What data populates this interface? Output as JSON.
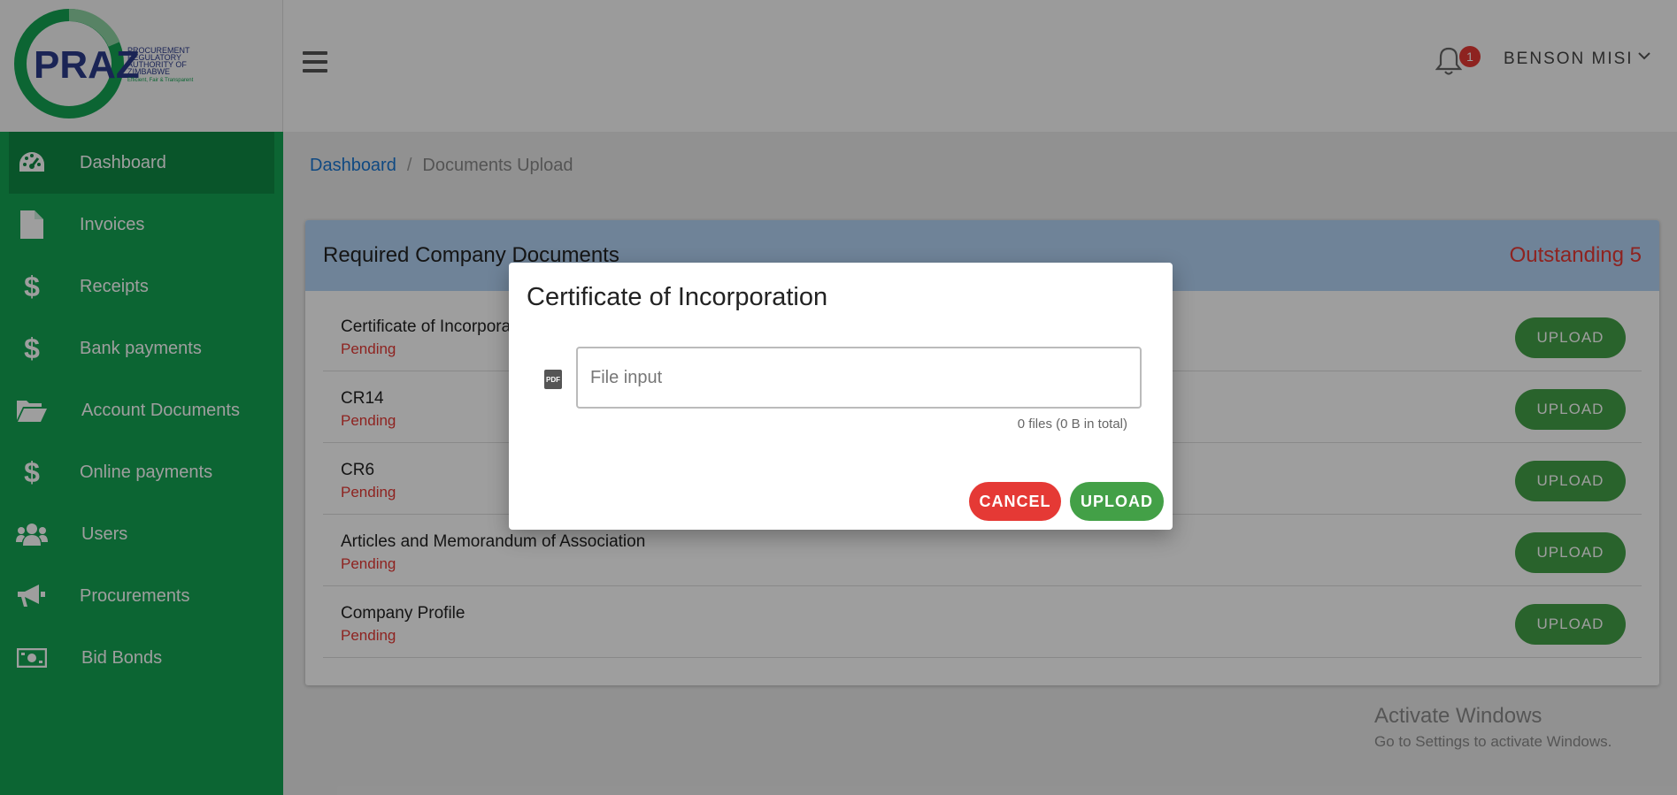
{
  "logo": {
    "acronym": "PRAZ",
    "name_lines": [
      "PROCUREMENT",
      "REGULATORY",
      "AUTHORITY OF",
      "ZIMBABWE"
    ],
    "tagline": "Efficient, Fair & Transparent"
  },
  "sidebar": {
    "items": [
      {
        "label": "Dashboard",
        "icon": "dashboard-gauge-icon"
      },
      {
        "label": "Invoices",
        "icon": "file-icon"
      },
      {
        "label": "Receipts",
        "icon": "dollar-icon"
      },
      {
        "label": "Bank payments",
        "icon": "dollar-icon"
      },
      {
        "label": "Account Documents",
        "icon": "folder-open-icon"
      },
      {
        "label": "Online payments",
        "icon": "dollar-icon"
      },
      {
        "label": "Users",
        "icon": "users-icon"
      },
      {
        "label": "Procurements",
        "icon": "megaphone-icon"
      },
      {
        "label": "Bid Bonds",
        "icon": "money-bill-icon"
      }
    ]
  },
  "header": {
    "notification_count": "1",
    "username": "BENSON MISI"
  },
  "breadcrumb": {
    "home": "Dashboard",
    "separator": "/",
    "current": "Documents Upload"
  },
  "card": {
    "title": "Required Company Documents",
    "outstanding": "Outstanding 5",
    "documents": [
      {
        "name": "Certificate of Incorporation",
        "status": "Pending",
        "button": "UPLOAD"
      },
      {
        "name": "CR14",
        "status": "Pending",
        "button": "UPLOAD"
      },
      {
        "name": "CR6",
        "status": "Pending",
        "button": "UPLOAD"
      },
      {
        "name": "Articles and Memorandum of Association",
        "status": "Pending",
        "button": "UPLOAD"
      },
      {
        "name": "Company Profile",
        "status": "Pending",
        "button": "UPLOAD"
      }
    ]
  },
  "modal": {
    "title": "Certificate of Incorporation",
    "file_placeholder": "File input",
    "file_count": "0 files (0 B in total)",
    "cancel_label": "CANCEL",
    "upload_label": "UPLOAD"
  },
  "watermark": {
    "line1": "Activate Windows",
    "line2": "Go to Settings to activate Windows."
  },
  "colors": {
    "sidebar": "#14a353",
    "sidebar_active": "#0f8a44",
    "card_header": "#b3d4f5",
    "pending": "#e53935",
    "upload_button": "#43a047",
    "cancel_button": "#e53935",
    "link": "#1976d2"
  }
}
